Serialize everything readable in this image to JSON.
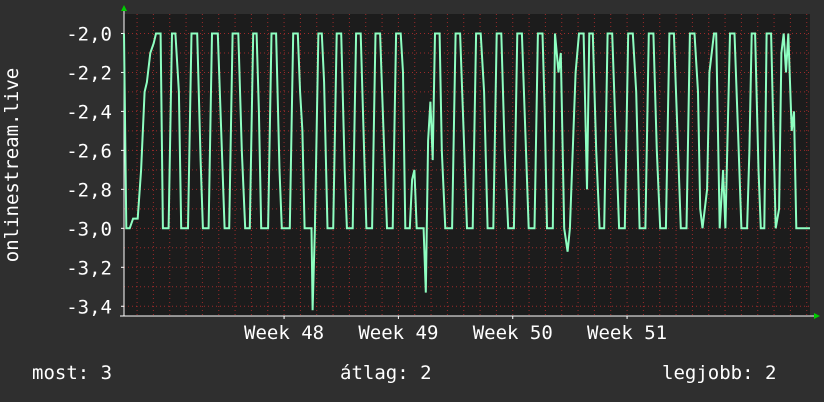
{
  "chart_data": {
    "type": "line",
    "ylabel": "onlinestream.live",
    "xlabel": "",
    "title": "",
    "ylim": [
      -3.45,
      -1.9
    ],
    "yticks": [
      "-2,0",
      "-2,2",
      "-2,4",
      "-2,6",
      "-2,8",
      "-3,0",
      "-3,2",
      "-3,4"
    ],
    "ytick_values": [
      -2.0,
      -2.2,
      -2.4,
      -2.6,
      -2.8,
      -3.0,
      -3.2,
      -3.4
    ],
    "xlim": [
      46.6,
      52.6
    ],
    "xticks": [
      "Week 48",
      "Week 49",
      "Week 50",
      "Week 51"
    ],
    "xtick_values": [
      48,
      49,
      50,
      51
    ],
    "grid": true,
    "colors": {
      "background": "#2f2f2f",
      "plot_bg": "#1c1c1c",
      "line": "#8effc1",
      "grid": "#d03030",
      "axis": "#ffffff",
      "arrow": "#00cc00"
    },
    "series": [
      {
        "values": [
          [
            46.6,
            -2.0
          ],
          [
            46.62,
            -3.0
          ],
          [
            46.65,
            -3.0
          ],
          [
            46.68,
            -2.95
          ],
          [
            46.72,
            -2.95
          ],
          [
            46.75,
            -2.7
          ],
          [
            46.78,
            -2.3
          ],
          [
            46.8,
            -2.25
          ],
          [
            46.83,
            -2.1
          ],
          [
            46.86,
            -2.05
          ],
          [
            46.88,
            -2.0
          ],
          [
            46.92,
            -2.0
          ],
          [
            46.94,
            -3.0
          ],
          [
            46.99,
            -3.0
          ],
          [
            47.02,
            -2.0
          ],
          [
            47.05,
            -2.0
          ],
          [
            47.08,
            -2.3
          ],
          [
            47.1,
            -3.0
          ],
          [
            47.16,
            -3.0
          ],
          [
            47.19,
            -2.0
          ],
          [
            47.24,
            -2.0
          ],
          [
            47.27,
            -2.65
          ],
          [
            47.29,
            -3.0
          ],
          [
            47.34,
            -3.0
          ],
          [
            47.37,
            -2.0
          ],
          [
            47.42,
            -2.0
          ],
          [
            47.45,
            -2.5
          ],
          [
            47.48,
            -3.0
          ],
          [
            47.52,
            -3.0
          ],
          [
            47.55,
            -2.0
          ],
          [
            47.6,
            -2.0
          ],
          [
            47.63,
            -2.6
          ],
          [
            47.66,
            -3.0
          ],
          [
            47.7,
            -3.0
          ],
          [
            47.73,
            -2.0
          ],
          [
            47.76,
            -2.0
          ],
          [
            47.78,
            -2.4
          ],
          [
            47.8,
            -3.0
          ],
          [
            47.86,
            -3.0
          ],
          [
            47.89,
            -2.0
          ],
          [
            47.93,
            -2.0
          ],
          [
            47.96,
            -2.7
          ],
          [
            47.98,
            -3.0
          ],
          [
            48.05,
            -3.0
          ],
          [
            48.08,
            -2.0
          ],
          [
            48.12,
            -2.0
          ],
          [
            48.14,
            -2.3
          ],
          [
            48.16,
            -2.5
          ],
          [
            48.18,
            -3.0
          ],
          [
            48.24,
            -3.0
          ],
          [
            48.25,
            -3.42
          ],
          [
            48.27,
            -3.0
          ],
          [
            48.3,
            -2.0
          ],
          [
            48.33,
            -2.0
          ],
          [
            48.35,
            -2.25
          ],
          [
            48.38,
            -3.0
          ],
          [
            48.43,
            -3.0
          ],
          [
            48.46,
            -2.0
          ],
          [
            48.5,
            -2.0
          ],
          [
            48.53,
            -2.7
          ],
          [
            48.55,
            -3.0
          ],
          [
            48.6,
            -3.0
          ],
          [
            48.63,
            -2.0
          ],
          [
            48.67,
            -2.0
          ],
          [
            48.7,
            -2.6
          ],
          [
            48.72,
            -3.0
          ],
          [
            48.77,
            -3.0
          ],
          [
            48.8,
            -2.0
          ],
          [
            48.84,
            -2.0
          ],
          [
            48.87,
            -2.5
          ],
          [
            48.9,
            -3.0
          ],
          [
            48.95,
            -3.0
          ],
          [
            48.98,
            -2.0
          ],
          [
            49.02,
            -2.0
          ],
          [
            49.04,
            -2.2
          ],
          [
            49.06,
            -3.0
          ],
          [
            49.1,
            -3.0
          ],
          [
            49.12,
            -2.75
          ],
          [
            49.14,
            -2.7
          ],
          [
            49.16,
            -3.0
          ],
          [
            49.22,
            -3.0
          ],
          [
            49.24,
            -3.33
          ],
          [
            49.26,
            -2.55
          ],
          [
            49.28,
            -2.35
          ],
          [
            49.3,
            -2.65
          ],
          [
            49.32,
            -2.0
          ],
          [
            49.36,
            -2.0
          ],
          [
            49.38,
            -2.6
          ],
          [
            49.41,
            -3.0
          ],
          [
            49.47,
            -3.0
          ],
          [
            49.5,
            -2.0
          ],
          [
            49.54,
            -2.0
          ],
          [
            49.57,
            -2.5
          ],
          [
            49.6,
            -3.0
          ],
          [
            49.65,
            -3.0
          ],
          [
            49.68,
            -2.0
          ],
          [
            49.72,
            -2.0
          ],
          [
            49.75,
            -2.3
          ],
          [
            49.78,
            -3.0
          ],
          [
            49.83,
            -3.0
          ],
          [
            49.86,
            -2.0
          ],
          [
            49.9,
            -2.0
          ],
          [
            49.93,
            -2.6
          ],
          [
            49.96,
            -3.0
          ],
          [
            50.01,
            -3.0
          ],
          [
            50.04,
            -2.0
          ],
          [
            50.08,
            -2.0
          ],
          [
            50.11,
            -2.5
          ],
          [
            50.14,
            -3.0
          ],
          [
            50.19,
            -3.0
          ],
          [
            50.22,
            -2.0
          ],
          [
            50.26,
            -2.0
          ],
          [
            50.28,
            -2.4
          ],
          [
            50.3,
            -3.0
          ],
          [
            50.35,
            -3.0
          ],
          [
            50.37,
            -2.0
          ],
          [
            50.4,
            -2.2
          ],
          [
            50.42,
            -2.1
          ],
          [
            50.45,
            -3.0
          ],
          [
            50.48,
            -3.12
          ],
          [
            50.5,
            -3.0
          ],
          [
            50.55,
            -2.2
          ],
          [
            50.58,
            -2.0
          ],
          [
            50.62,
            -2.0
          ],
          [
            50.65,
            -2.8
          ],
          [
            50.67,
            -2.0
          ],
          [
            50.7,
            -2.0
          ],
          [
            50.73,
            -2.6
          ],
          [
            50.76,
            -3.0
          ],
          [
            50.8,
            -3.0
          ],
          [
            50.83,
            -2.0
          ],
          [
            50.87,
            -2.0
          ],
          [
            50.9,
            -2.5
          ],
          [
            50.93,
            -3.0
          ],
          [
            50.98,
            -3.0
          ],
          [
            51.01,
            -2.0
          ],
          [
            51.05,
            -2.0
          ],
          [
            51.08,
            -2.3
          ],
          [
            51.11,
            -3.0
          ],
          [
            51.16,
            -3.0
          ],
          [
            51.19,
            -2.0
          ],
          [
            51.23,
            -2.0
          ],
          [
            51.26,
            -2.6
          ],
          [
            51.29,
            -3.0
          ],
          [
            51.34,
            -3.0
          ],
          [
            51.37,
            -2.0
          ],
          [
            51.41,
            -2.0
          ],
          [
            51.44,
            -2.5
          ],
          [
            51.47,
            -3.0
          ],
          [
            51.52,
            -3.0
          ],
          [
            51.55,
            -2.0
          ],
          [
            51.59,
            -2.0
          ],
          [
            51.62,
            -2.3
          ],
          [
            51.64,
            -2.9
          ],
          [
            51.66,
            -3.0
          ],
          [
            51.7,
            -2.8
          ],
          [
            51.72,
            -2.2
          ],
          [
            51.74,
            -2.1
          ],
          [
            51.76,
            -2.0
          ],
          [
            51.78,
            -2.0
          ],
          [
            51.81,
            -3.0
          ],
          [
            51.84,
            -2.7
          ],
          [
            51.86,
            -3.0
          ],
          [
            51.9,
            -2.0
          ],
          [
            51.94,
            -2.0
          ],
          [
            51.97,
            -2.5
          ],
          [
            52.0,
            -3.0
          ],
          [
            52.05,
            -3.0
          ],
          [
            52.07,
            -2.6
          ],
          [
            52.09,
            -2.0
          ],
          [
            52.12,
            -2.0
          ],
          [
            52.15,
            -2.7
          ],
          [
            52.17,
            -3.0
          ],
          [
            52.2,
            -3.0
          ],
          [
            52.22,
            -2.0
          ],
          [
            52.26,
            -2.0
          ],
          [
            52.28,
            -2.5
          ],
          [
            52.3,
            -3.0
          ],
          [
            52.33,
            -2.9
          ],
          [
            52.35,
            -2.1
          ],
          [
            52.37,
            -2.0
          ],
          [
            52.39,
            -2.2
          ],
          [
            52.41,
            -2.0
          ],
          [
            52.44,
            -2.5
          ],
          [
            52.46,
            -2.4
          ],
          [
            52.48,
            -3.0
          ],
          [
            52.6,
            -3.0
          ]
        ]
      }
    ]
  },
  "legend": {
    "now_label": "most:",
    "now_value": "3",
    "avg_label": "átlag:",
    "avg_value": "2",
    "best_label": "legjobb:",
    "best_value": "2"
  }
}
